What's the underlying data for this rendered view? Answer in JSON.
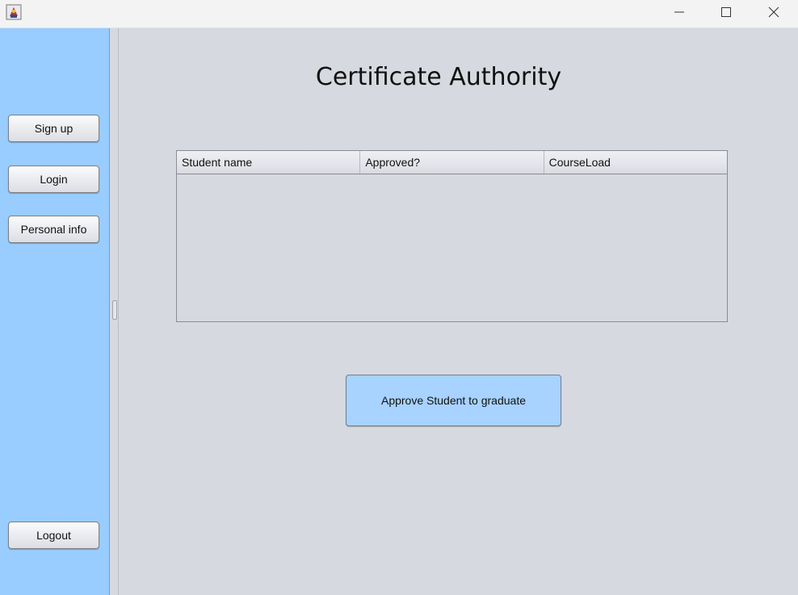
{
  "titlebar": {
    "app_icon": "java-app-icon",
    "minimize_icon": "minimize-icon",
    "maximize_icon": "maximize-icon",
    "close_icon": "close-icon"
  },
  "sidebar": {
    "buttons": [
      {
        "label": "Sign up"
      },
      {
        "label": "Login"
      },
      {
        "label": "Personal info"
      }
    ],
    "logout_label": "Logout",
    "background_color": "#99ccff"
  },
  "main": {
    "title": "Certificate Authority",
    "table": {
      "columns": [
        "Student name",
        "Approved?",
        "CourseLoad"
      ],
      "rows": []
    },
    "approve_label": "Approve Student to graduate",
    "approve_color": "#a8d2ff"
  }
}
